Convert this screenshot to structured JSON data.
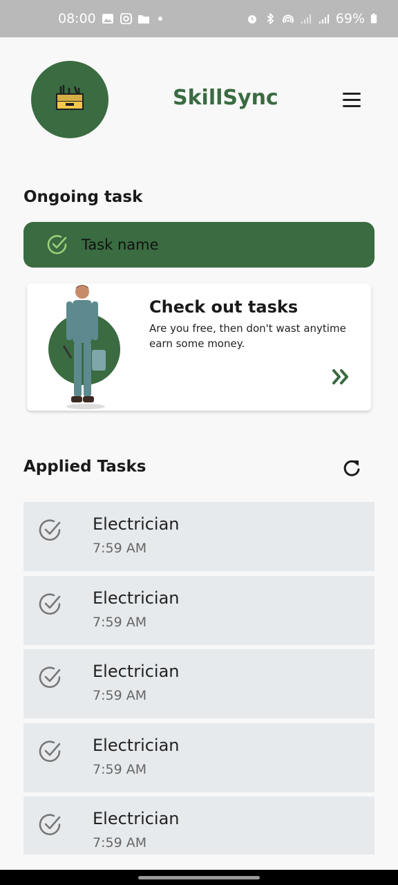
{
  "status_bar": {
    "time": "08:00",
    "battery": "69%"
  },
  "header": {
    "app_title": "SkillSync",
    "logo_icon": "toolbox-icon",
    "menu_icon": "hamburger-menu-icon"
  },
  "ongoing": {
    "section_title": "Ongoing task",
    "task_label": "Task name"
  },
  "promo": {
    "title": "Check out tasks",
    "description": "Are you free, then don't wast anytime earn some money."
  },
  "applied": {
    "section_title": "Applied Tasks",
    "items": [
      {
        "name": "Electrician",
        "time": "7:59 AM"
      },
      {
        "name": "Electrician",
        "time": "7:59 AM"
      },
      {
        "name": "Electrician",
        "time": "7:59 AM"
      },
      {
        "name": "Electrician",
        "time": "7:59 AM"
      },
      {
        "name": "Electrician",
        "time": "7:59 AM"
      }
    ]
  },
  "colors": {
    "brand_green": "#3a6b41",
    "list_bg": "#e6eaed",
    "status_bar": "#b9b9b9"
  }
}
